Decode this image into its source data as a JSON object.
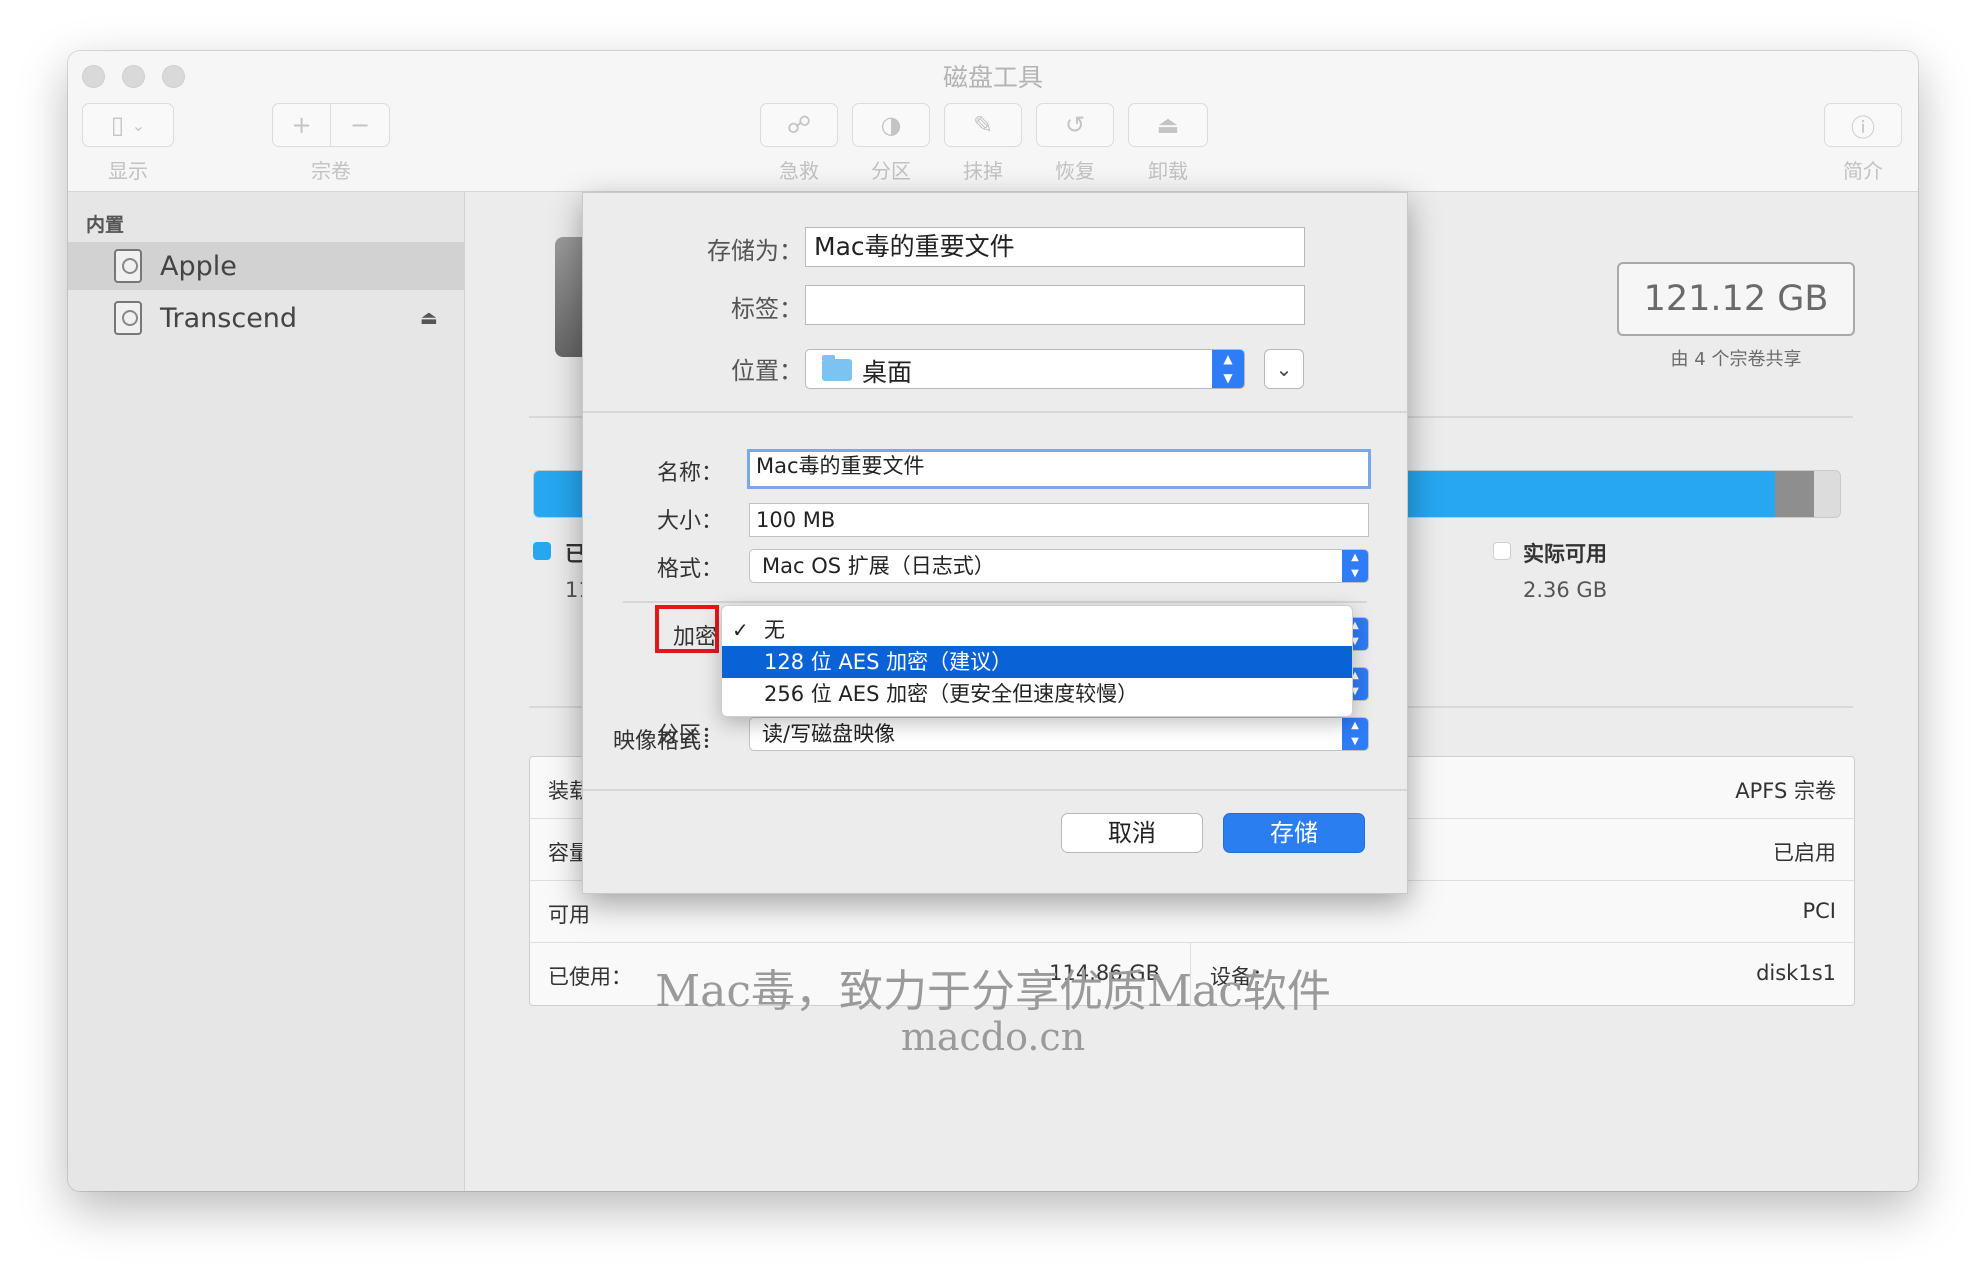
{
  "window": {
    "title": "磁盘工具",
    "toolbar": {
      "view_label": "显示",
      "volume_label": "宗卷",
      "firstaid_label": "急救",
      "partition_label": "分区",
      "erase_label": "抹掉",
      "restore_label": "恢复",
      "unmount_label": "卸载",
      "info_label": "简介"
    }
  },
  "sidebar": {
    "section": "内置",
    "items": [
      {
        "label": "Apple"
      },
      {
        "label": "Transcend"
      }
    ]
  },
  "main": {
    "capacity": "121.12 GB",
    "capacity_sub": "由 4 个宗卷共享",
    "legend": {
      "used_title": "已",
      "used_value": "11",
      "free_title": "实际可用",
      "free_value": "2.36 GB"
    },
    "usage": {
      "used_fraction": 0.95,
      "other_fraction": 0.03
    },
    "info_rows": [
      {
        "left": "装载",
        "left_value": "",
        "right": "",
        "right_value": "APFS 宗卷"
      },
      {
        "left": "容量",
        "left_value": "",
        "right": "",
        "right_value": "已启用"
      },
      {
        "left": "可用",
        "left_value": "",
        "right": "",
        "right_value": "PCI"
      },
      {
        "left": "已使用：",
        "left_value": "114.86 GB",
        "right": "设备：",
        "right_value": "disk1s1"
      }
    ]
  },
  "watermark": {
    "line1": "Mac毒，致力于分享优质Mac软件",
    "line2": "macdo.cn"
  },
  "dialog": {
    "save_as_label": "存储为：",
    "save_as_value": "Mac毒的重要文件",
    "tags_label": "标签：",
    "tags_value": "",
    "location_label": "位置：",
    "location_value": "桌面",
    "name_label": "名称：",
    "name_value": "Mac毒的重要文件",
    "size_label": "大小：",
    "size_value": "100 MB",
    "format_label": "格式：",
    "format_value": "Mac OS 扩展（日志式）",
    "encryption_label": "加密",
    "partition_label": "分区：",
    "image_format_label": "映像格式：",
    "image_format_value": "读/写磁盘映像",
    "encryption_menu": [
      {
        "label": "无",
        "checked": true
      },
      {
        "label": "128 位 AES 加密（建议）",
        "highlighted": true
      },
      {
        "label": "256 位 AES 加密（更安全但速度较慢）"
      }
    ],
    "cancel_label": "取消",
    "save_label": "存储"
  }
}
